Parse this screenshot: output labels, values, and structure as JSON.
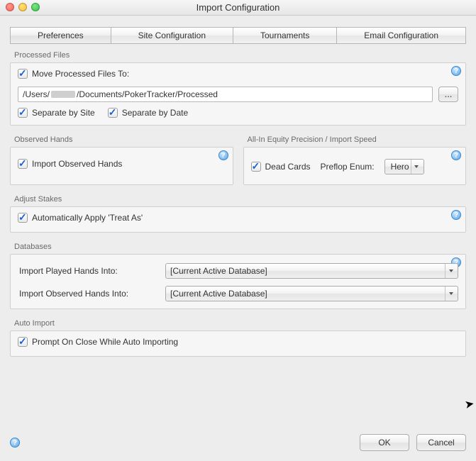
{
  "title": "Import Configuration",
  "tabs": {
    "preferences": "Preferences",
    "site": "Site Configuration",
    "tournaments": "Tournaments",
    "email": "Email Configuration"
  },
  "processed_files": {
    "group_label": "Processed Files",
    "move_label": "Move Processed Files To:",
    "move_checked": true,
    "path_prefix": "/Users/",
    "path_suffix": "/Documents/PokerTracker/Processed",
    "browse_label": "...",
    "separate_site_label": "Separate by Site",
    "separate_site_checked": true,
    "separate_date_label": "Separate by Date",
    "separate_date_checked": true
  },
  "observed": {
    "group_label": "Observed Hands",
    "import_label": "Import Observed Hands",
    "import_checked": true
  },
  "allin": {
    "group_label": "All-In Equity Precision / Import Speed",
    "dead_cards_label": "Dead Cards",
    "dead_cards_checked": true,
    "preflop_enum_label": "Preflop Enum:",
    "preflop_enum_value": "Hero"
  },
  "adjust_stakes": {
    "group_label": "Adjust Stakes",
    "treat_as_label": "Automatically Apply 'Treat As'",
    "treat_as_checked": true
  },
  "databases": {
    "group_label": "Databases",
    "played_label": "Import Played Hands Into:",
    "played_value": "[Current Active Database]",
    "observed_label": "Import Observed Hands Into:",
    "observed_value": "[Current Active Database]"
  },
  "auto_import": {
    "group_label": "Auto Import",
    "prompt_label": "Prompt On Close While Auto Importing",
    "prompt_checked": true
  },
  "buttons": {
    "ok": "OK",
    "cancel": "Cancel"
  },
  "help_glyph": "?"
}
